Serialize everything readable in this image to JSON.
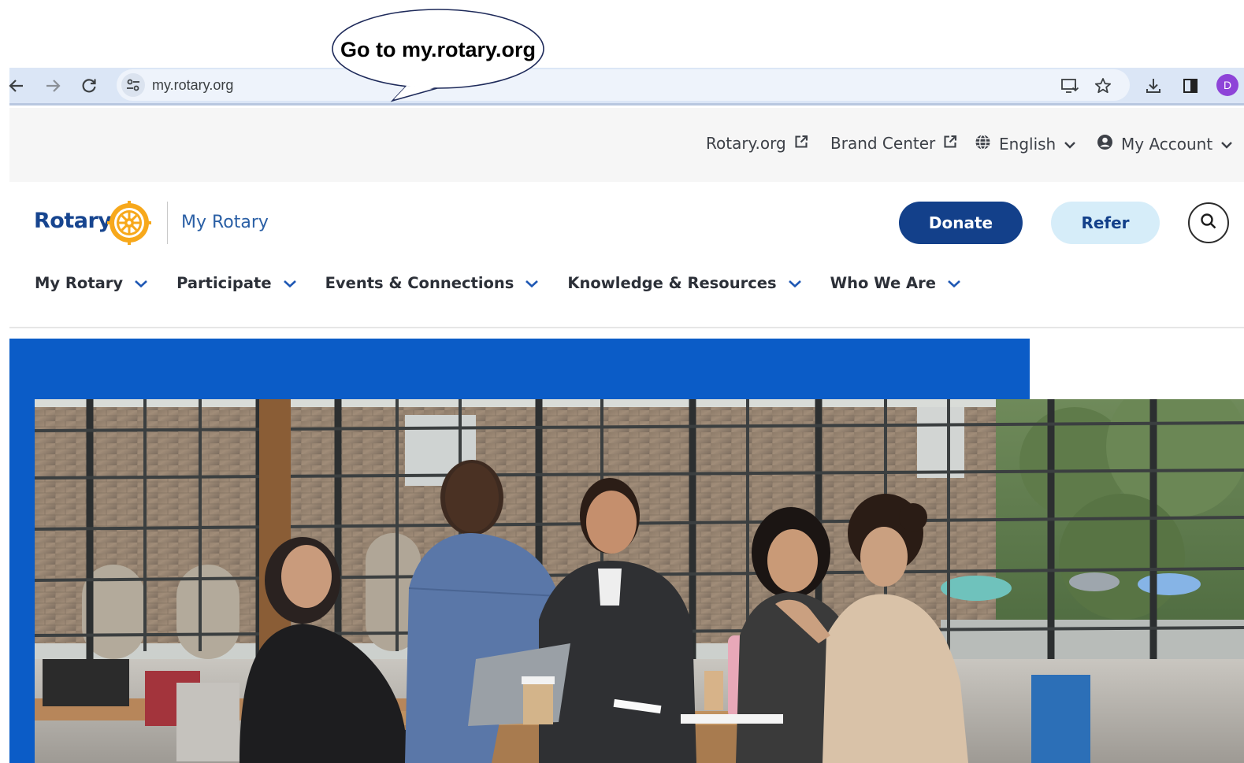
{
  "callout": {
    "text": "Go to my.rotary.org"
  },
  "browser": {
    "url": "my.rotary.org",
    "avatar_letter": "D",
    "icons": [
      "back-arrow-icon",
      "forward-arrow-icon",
      "reload-icon",
      "site-settings-icon",
      "install-app-icon",
      "bookmark-star-icon",
      "download-icon",
      "side-panel-icon"
    ]
  },
  "utility": {
    "rotary_org": "Rotary.org",
    "brand_center": "Brand Center",
    "language": "English",
    "account": "My Account"
  },
  "header": {
    "logo_text": "Rotary",
    "site_title": "My Rotary",
    "donate_label": "Donate",
    "refer_label": "Refer"
  },
  "nav": {
    "items": [
      {
        "label": "My Rotary"
      },
      {
        "label": "Participate"
      },
      {
        "label": "Events & Connections"
      },
      {
        "label": "Knowledge & Resources"
      },
      {
        "label": "Who We Are"
      }
    ]
  },
  "colors": {
    "rotary_blue": "#17458f",
    "donate_bg": "#13408a",
    "refer_bg": "#d6edf9",
    "hero_blue": "#0b5cc7",
    "wheel_gold": "#f7a81b"
  }
}
